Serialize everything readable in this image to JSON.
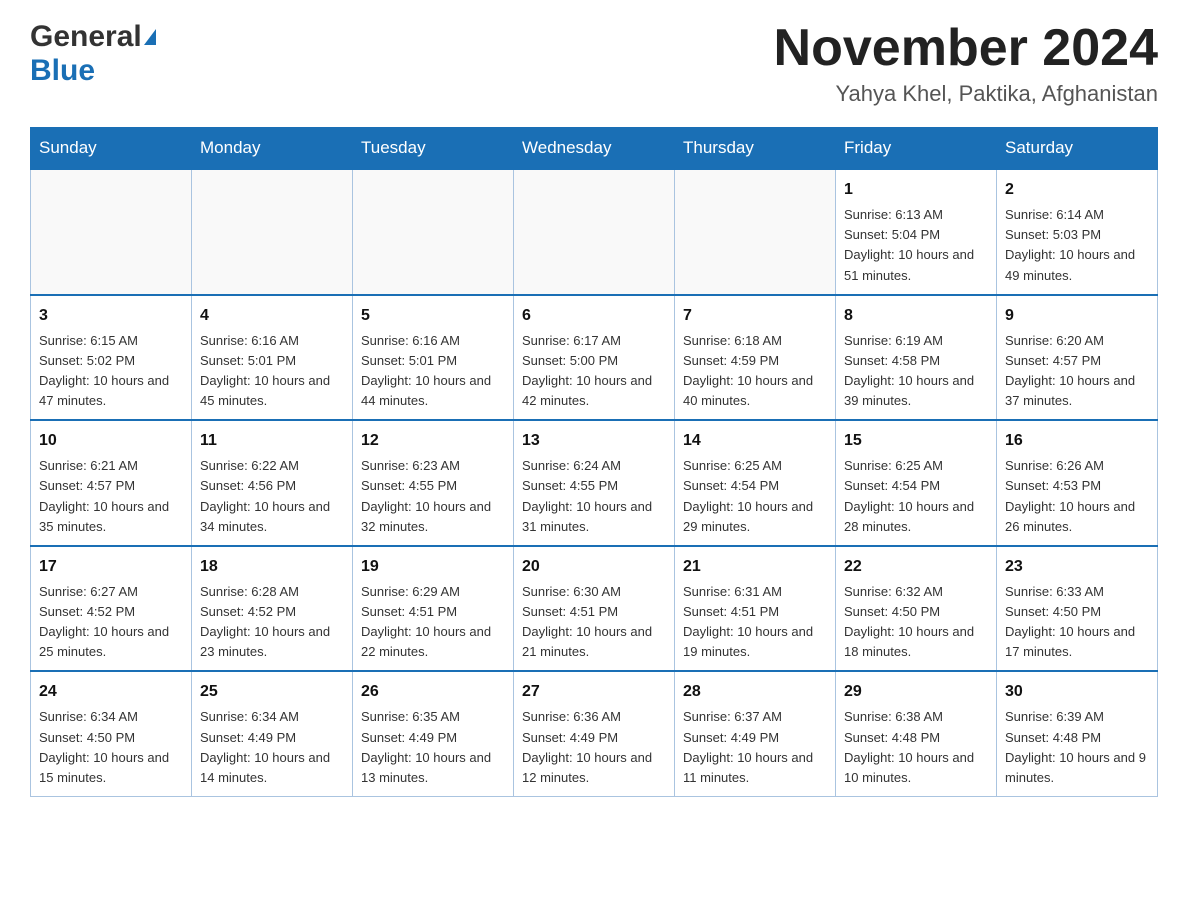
{
  "header": {
    "logo_general": "General",
    "logo_arrow": "▶",
    "logo_blue": "Blue",
    "month_title": "November 2024",
    "location": "Yahya Khel, Paktika, Afghanistan"
  },
  "weekdays": [
    "Sunday",
    "Monday",
    "Tuesday",
    "Wednesday",
    "Thursday",
    "Friday",
    "Saturday"
  ],
  "weeks": [
    [
      {
        "day": "",
        "info": ""
      },
      {
        "day": "",
        "info": ""
      },
      {
        "day": "",
        "info": ""
      },
      {
        "day": "",
        "info": ""
      },
      {
        "day": "",
        "info": ""
      },
      {
        "day": "1",
        "info": "Sunrise: 6:13 AM\nSunset: 5:04 PM\nDaylight: 10 hours\nand 51 minutes."
      },
      {
        "day": "2",
        "info": "Sunrise: 6:14 AM\nSunset: 5:03 PM\nDaylight: 10 hours\nand 49 minutes."
      }
    ],
    [
      {
        "day": "3",
        "info": "Sunrise: 6:15 AM\nSunset: 5:02 PM\nDaylight: 10 hours\nand 47 minutes."
      },
      {
        "day": "4",
        "info": "Sunrise: 6:16 AM\nSunset: 5:01 PM\nDaylight: 10 hours\nand 45 minutes."
      },
      {
        "day": "5",
        "info": "Sunrise: 6:16 AM\nSunset: 5:01 PM\nDaylight: 10 hours\nand 44 minutes."
      },
      {
        "day": "6",
        "info": "Sunrise: 6:17 AM\nSunset: 5:00 PM\nDaylight: 10 hours\nand 42 minutes."
      },
      {
        "day": "7",
        "info": "Sunrise: 6:18 AM\nSunset: 4:59 PM\nDaylight: 10 hours\nand 40 minutes."
      },
      {
        "day": "8",
        "info": "Sunrise: 6:19 AM\nSunset: 4:58 PM\nDaylight: 10 hours\nand 39 minutes."
      },
      {
        "day": "9",
        "info": "Sunrise: 6:20 AM\nSunset: 4:57 PM\nDaylight: 10 hours\nand 37 minutes."
      }
    ],
    [
      {
        "day": "10",
        "info": "Sunrise: 6:21 AM\nSunset: 4:57 PM\nDaylight: 10 hours\nand 35 minutes."
      },
      {
        "day": "11",
        "info": "Sunrise: 6:22 AM\nSunset: 4:56 PM\nDaylight: 10 hours\nand 34 minutes."
      },
      {
        "day": "12",
        "info": "Sunrise: 6:23 AM\nSunset: 4:55 PM\nDaylight: 10 hours\nand 32 minutes."
      },
      {
        "day": "13",
        "info": "Sunrise: 6:24 AM\nSunset: 4:55 PM\nDaylight: 10 hours\nand 31 minutes."
      },
      {
        "day": "14",
        "info": "Sunrise: 6:25 AM\nSunset: 4:54 PM\nDaylight: 10 hours\nand 29 minutes."
      },
      {
        "day": "15",
        "info": "Sunrise: 6:25 AM\nSunset: 4:54 PM\nDaylight: 10 hours\nand 28 minutes."
      },
      {
        "day": "16",
        "info": "Sunrise: 6:26 AM\nSunset: 4:53 PM\nDaylight: 10 hours\nand 26 minutes."
      }
    ],
    [
      {
        "day": "17",
        "info": "Sunrise: 6:27 AM\nSunset: 4:52 PM\nDaylight: 10 hours\nand 25 minutes."
      },
      {
        "day": "18",
        "info": "Sunrise: 6:28 AM\nSunset: 4:52 PM\nDaylight: 10 hours\nand 23 minutes."
      },
      {
        "day": "19",
        "info": "Sunrise: 6:29 AM\nSunset: 4:51 PM\nDaylight: 10 hours\nand 22 minutes."
      },
      {
        "day": "20",
        "info": "Sunrise: 6:30 AM\nSunset: 4:51 PM\nDaylight: 10 hours\nand 21 minutes."
      },
      {
        "day": "21",
        "info": "Sunrise: 6:31 AM\nSunset: 4:51 PM\nDaylight: 10 hours\nand 19 minutes."
      },
      {
        "day": "22",
        "info": "Sunrise: 6:32 AM\nSunset: 4:50 PM\nDaylight: 10 hours\nand 18 minutes."
      },
      {
        "day": "23",
        "info": "Sunrise: 6:33 AM\nSunset: 4:50 PM\nDaylight: 10 hours\nand 17 minutes."
      }
    ],
    [
      {
        "day": "24",
        "info": "Sunrise: 6:34 AM\nSunset: 4:50 PM\nDaylight: 10 hours\nand 15 minutes."
      },
      {
        "day": "25",
        "info": "Sunrise: 6:34 AM\nSunset: 4:49 PM\nDaylight: 10 hours\nand 14 minutes."
      },
      {
        "day": "26",
        "info": "Sunrise: 6:35 AM\nSunset: 4:49 PM\nDaylight: 10 hours\nand 13 minutes."
      },
      {
        "day": "27",
        "info": "Sunrise: 6:36 AM\nSunset: 4:49 PM\nDaylight: 10 hours\nand 12 minutes."
      },
      {
        "day": "28",
        "info": "Sunrise: 6:37 AM\nSunset: 4:49 PM\nDaylight: 10 hours\nand 11 minutes."
      },
      {
        "day": "29",
        "info": "Sunrise: 6:38 AM\nSunset: 4:48 PM\nDaylight: 10 hours\nand 10 minutes."
      },
      {
        "day": "30",
        "info": "Sunrise: 6:39 AM\nSunset: 4:48 PM\nDaylight: 10 hours\nand 9 minutes."
      }
    ]
  ]
}
